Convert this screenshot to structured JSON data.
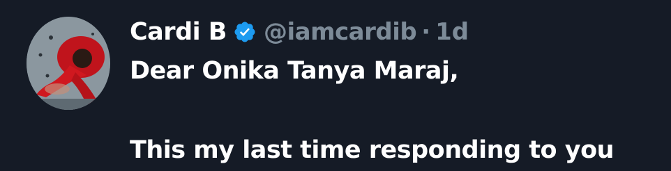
{
  "tweet": {
    "author": {
      "display_name": "Cardi B",
      "handle": "@iamcardib",
      "verified": true,
      "verified_color": "#1d9bf0",
      "avatar_icon": "profile-photo"
    },
    "separator": "·",
    "timestamp": "1d",
    "text_lines": [
      "Dear Onika Tanya Maraj,",
      "",
      "This my last time responding to you"
    ]
  },
  "colors": {
    "background": "#151b26",
    "text": "#ffffff",
    "muted": "#7d8b98"
  }
}
